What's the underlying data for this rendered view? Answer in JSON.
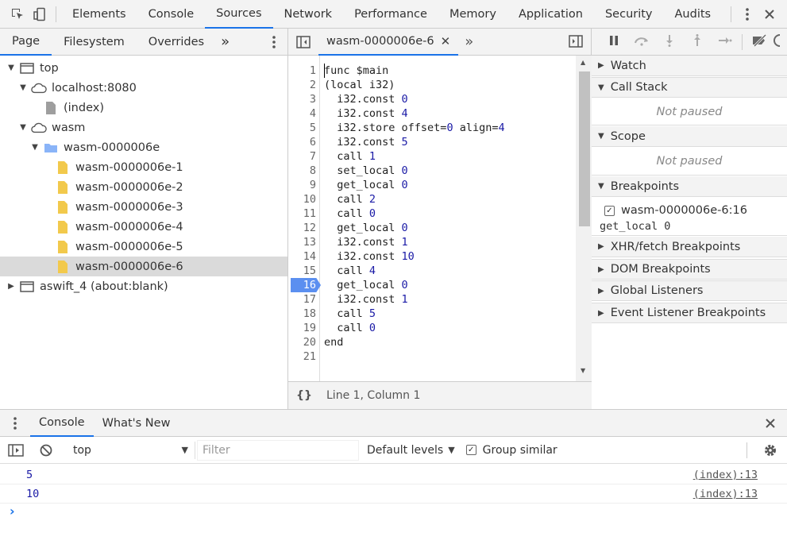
{
  "top_tabs": [
    "Elements",
    "Console",
    "Sources",
    "Network",
    "Performance",
    "Memory",
    "Application",
    "Security",
    "Audits"
  ],
  "active_top_tab": "Sources",
  "navigator": {
    "tabs": [
      "Page",
      "Filesystem",
      "Overrides"
    ],
    "more": "»",
    "tree": [
      {
        "label": "top",
        "depth": 0,
        "expanded": true,
        "icon": "frame-icon"
      },
      {
        "label": "localhost:8080",
        "depth": 1,
        "expanded": true,
        "icon": "cloud-icon"
      },
      {
        "label": "(index)",
        "depth": 2,
        "icon": "file-gray-icon"
      },
      {
        "label": "wasm",
        "depth": 1,
        "expanded": true,
        "icon": "cloud-icon"
      },
      {
        "label": "wasm-0000006e",
        "depth": 2,
        "expanded": true,
        "icon": "folder-icon"
      },
      {
        "label": "wasm-0000006e-1",
        "depth": 3,
        "icon": "file-yellow-icon"
      },
      {
        "label": "wasm-0000006e-2",
        "depth": 3,
        "icon": "file-yellow-icon"
      },
      {
        "label": "wasm-0000006e-3",
        "depth": 3,
        "icon": "file-yellow-icon"
      },
      {
        "label": "wasm-0000006e-4",
        "depth": 3,
        "icon": "file-yellow-icon"
      },
      {
        "label": "wasm-0000006e-5",
        "depth": 3,
        "icon": "file-yellow-icon"
      },
      {
        "label": "wasm-0000006e-6",
        "depth": 3,
        "icon": "file-yellow-icon",
        "selected": true
      },
      {
        "label": "aswift_4 (about:blank)",
        "depth": 0,
        "expanded": false,
        "icon": "frame-icon"
      }
    ]
  },
  "editor": {
    "tab_label": "wasm-0000006e-6",
    "more": "»",
    "breakpoint_line": 16,
    "lines": [
      "func $main",
      "(local i32)",
      "  i32.const 0",
      "  i32.const 4",
      "  i32.store offset=0 align=4",
      "  i32.const 5",
      "  call 1",
      "  set_local 0",
      "  get_local 0",
      "  call 2",
      "  call 0",
      "  get_local 0",
      "  i32.const 1",
      "  i32.const 10",
      "  call 4",
      "  get_local 0",
      "  i32.const 1",
      "  call 5",
      "  call 0",
      "end",
      ""
    ],
    "status_braces": "{}",
    "status_position": "Line 1, Column 1"
  },
  "debugger": {
    "watch": "Watch",
    "call_stack": "Call Stack",
    "call_stack_body": "Not paused",
    "scope": "Scope",
    "scope_body": "Not paused",
    "breakpoints": "Breakpoints",
    "breakpoint_file": "wasm-0000006e-6:16",
    "breakpoint_code": "get_local 0",
    "xhr": "XHR/fetch Breakpoints",
    "dom": "DOM Breakpoints",
    "global": "Global Listeners",
    "event": "Event Listener Breakpoints"
  },
  "drawer": {
    "tabs": [
      "Console",
      "What's New"
    ],
    "context": "top",
    "filter_placeholder": "Filter",
    "levels": "Default levels",
    "group_similar": "Group similar",
    "messages": [
      {
        "value": "5",
        "source": "(index):13"
      },
      {
        "value": "10",
        "source": "(index):13"
      }
    ],
    "prompt": "›"
  },
  "colors": {
    "accent": "#1a73e8",
    "breakpoint": "#5b8ff0",
    "number": "#1a1aa6",
    "folder": "#8ab4f8",
    "file": "#f2c94c"
  }
}
